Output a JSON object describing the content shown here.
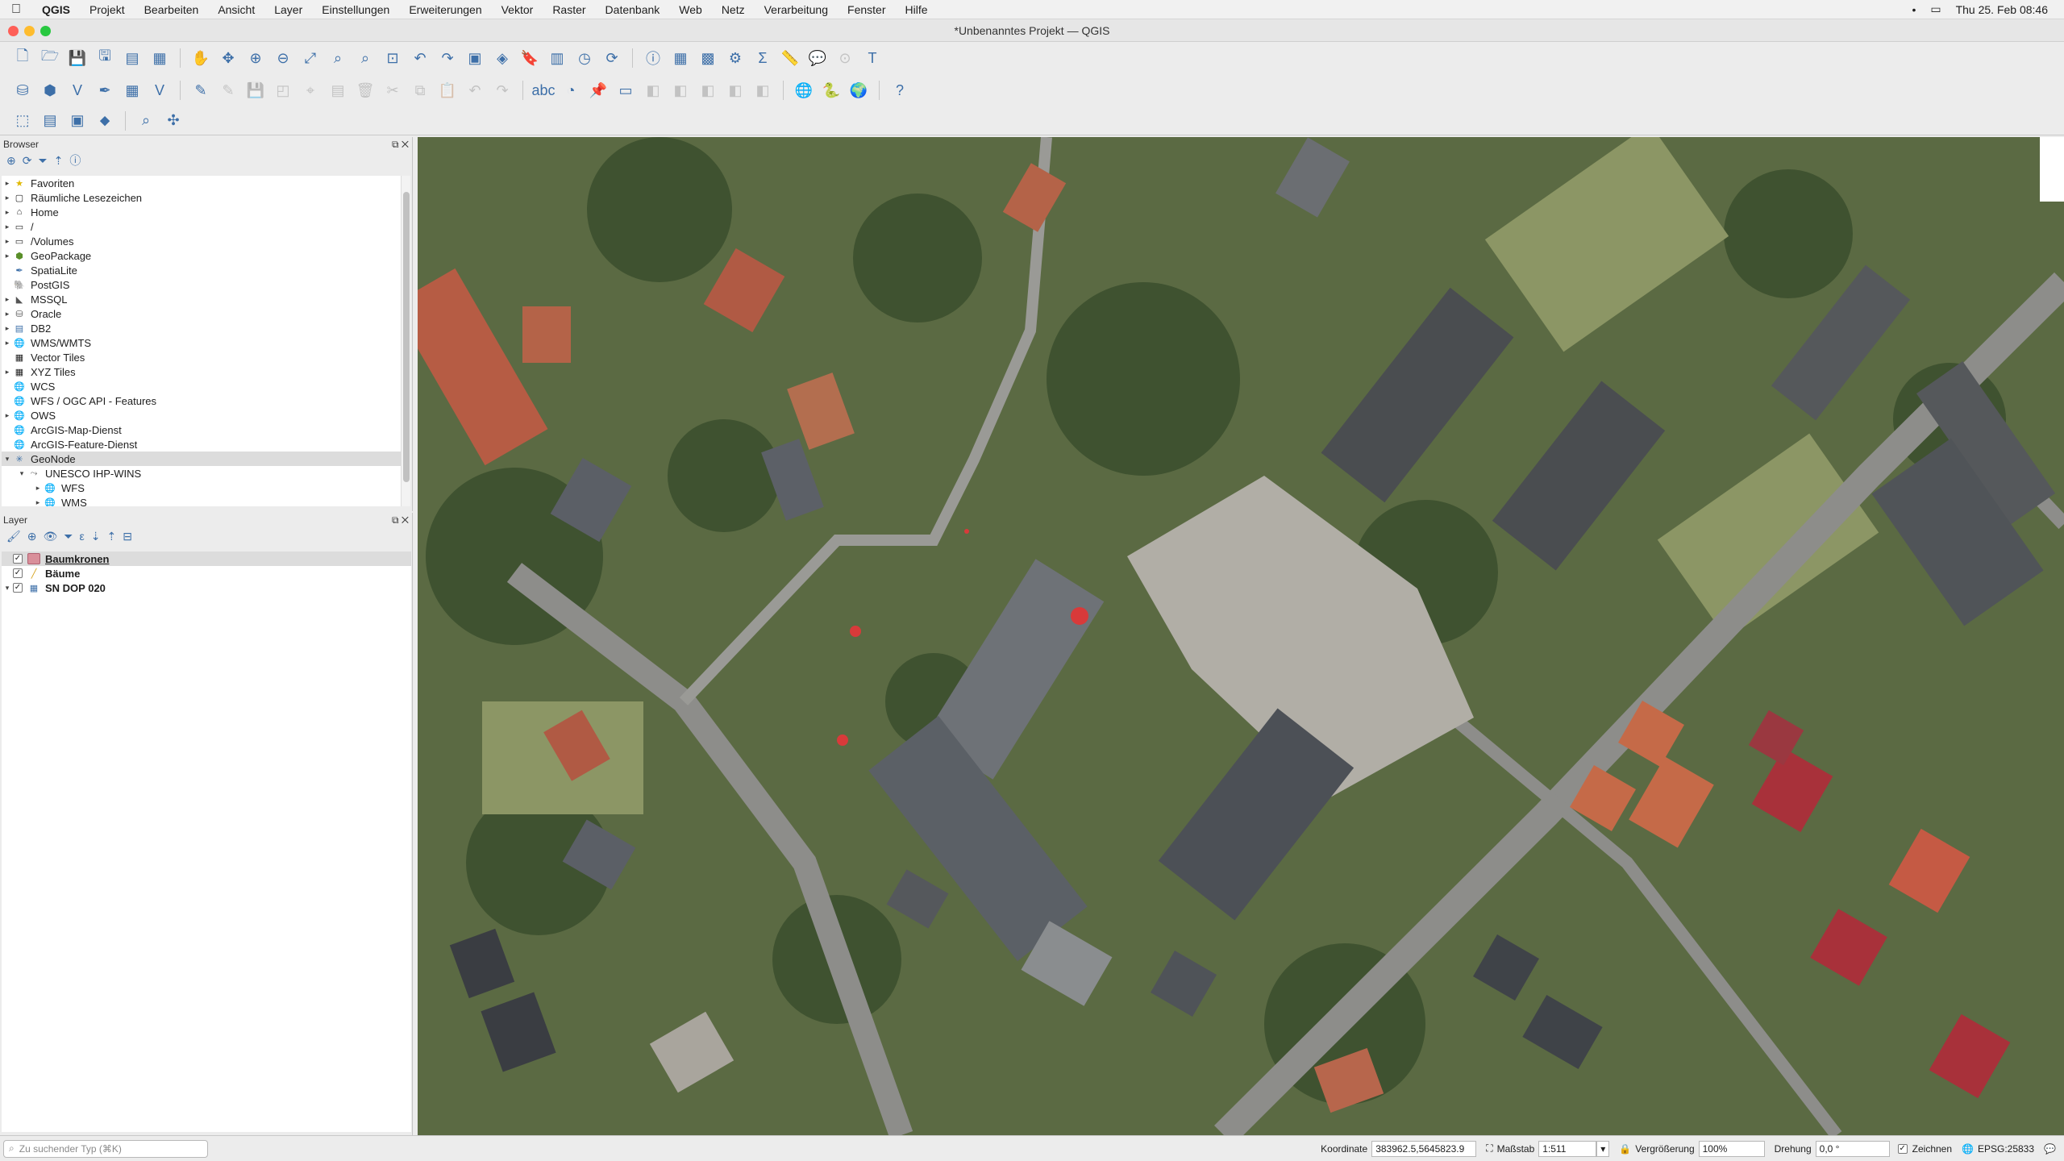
{
  "menubar": {
    "app": "QGIS",
    "items": [
      "Projekt",
      "Bearbeiten",
      "Ansicht",
      "Layer",
      "Einstellungen",
      "Erweiterungen",
      "Vektor",
      "Raster",
      "Datenbank",
      "Web",
      "Netz",
      "Verarbeitung",
      "Fenster",
      "Hilfe"
    ],
    "clock": "Thu 25. Feb  08:46"
  },
  "window": {
    "title": "*Unbenanntes Projekt — QGIS"
  },
  "browser": {
    "title": "Browser",
    "items": [
      {
        "label": "Favoriten",
        "icon": "star-icon"
      },
      {
        "label": "Räumliche Lesezeichen",
        "icon": "bookmark-icon"
      },
      {
        "label": "Home",
        "icon": "home-icon"
      },
      {
        "label": "/",
        "icon": "folder-icon"
      },
      {
        "label": "/Volumes",
        "icon": "folder-icon"
      },
      {
        "label": "GeoPackage",
        "icon": "geopackage-icon"
      },
      {
        "label": "SpatiaLite",
        "icon": "spatialite-icon"
      },
      {
        "label": "PostGIS",
        "icon": "postgis-icon"
      },
      {
        "label": "MSSQL",
        "icon": "mssql-icon"
      },
      {
        "label": "Oracle",
        "icon": "oracle-icon"
      },
      {
        "label": "DB2",
        "icon": "db2-icon"
      },
      {
        "label": "WMS/WMTS",
        "icon": "wms-icon"
      },
      {
        "label": "Vector Tiles",
        "icon": "vector-tiles-icon"
      },
      {
        "label": "XYZ Tiles",
        "icon": "xyz-tiles-icon"
      },
      {
        "label": "WCS",
        "icon": "wcs-icon"
      },
      {
        "label": "WFS / OGC API - Features",
        "icon": "wfs-icon"
      },
      {
        "label": "OWS",
        "icon": "ows-icon"
      },
      {
        "label": "ArcGIS-Map-Dienst",
        "icon": "arcgis-icon"
      },
      {
        "label": "ArcGIS-Feature-Dienst",
        "icon": "arcgis-icon"
      },
      {
        "label": "GeoNode",
        "icon": "geonode-icon"
      },
      {
        "label": "UNESCO IHP-WINS",
        "icon": "connection-icon"
      },
      {
        "label": "WFS",
        "icon": "wfs-icon"
      },
      {
        "label": "WMS",
        "icon": "wms-icon"
      }
    ]
  },
  "layers": {
    "title": "Layer",
    "items": [
      {
        "label": "Baumkronen",
        "checked": true,
        "icon": "polygon-layer-icon"
      },
      {
        "label": "Bäume",
        "checked": true,
        "icon": "line-layer-icon"
      },
      {
        "label": "SN DOP 020",
        "checked": true,
        "icon": "raster-layer-icon"
      }
    ]
  },
  "status": {
    "locator_placeholder": "Zu suchender Typ (⌘K)",
    "coordinate_label": "Koordinate",
    "coordinate_value": "383962.5,5645823.9",
    "scale_label": "Maßstab",
    "scale_value": "1:511",
    "magnifier_label": "Vergrößerung",
    "magnifier_value": "100%",
    "rotation_label": "Drehung",
    "rotation_value": "0,0 °",
    "render_label": "Zeichnen",
    "crs": "EPSG:25833"
  },
  "map": {
    "tree_color": "#d83a3a"
  }
}
